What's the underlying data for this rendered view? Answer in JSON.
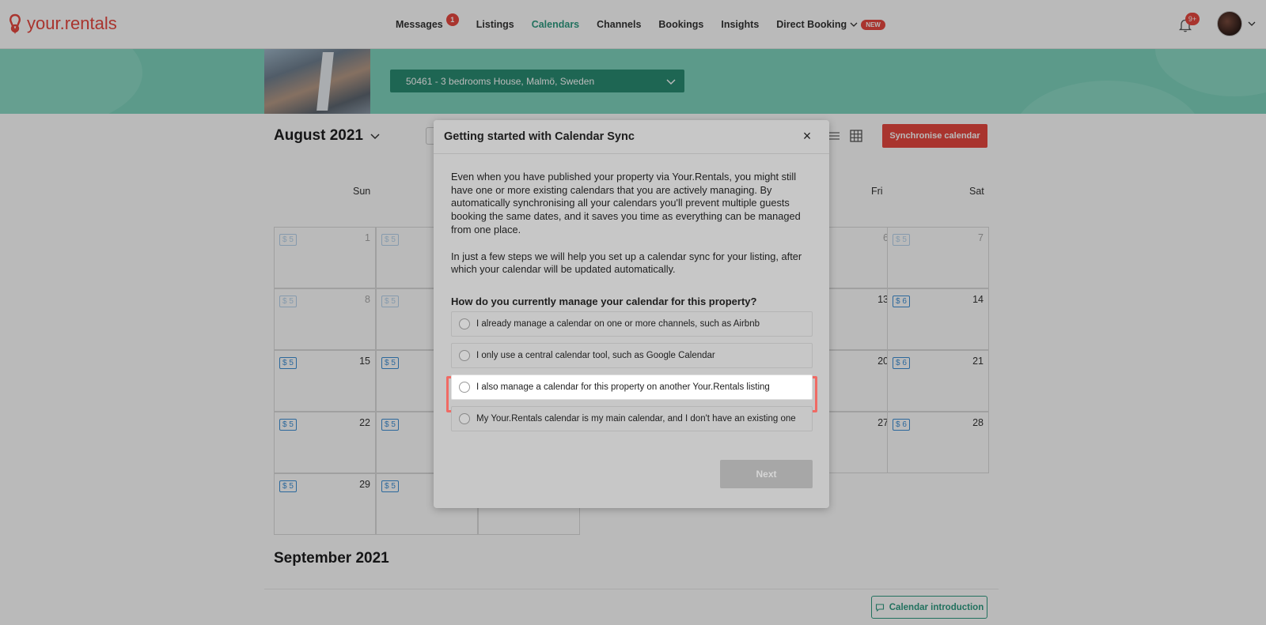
{
  "app": {
    "logo_text": "your.rentals"
  },
  "nav": {
    "items": [
      {
        "label": "Messages",
        "badge": "1"
      },
      {
        "label": "Listings"
      },
      {
        "label": "Calendars",
        "active": true
      },
      {
        "label": "Channels"
      },
      {
        "label": "Bookings"
      },
      {
        "label": "Insights"
      },
      {
        "label": "Direct Booking",
        "tag": "NEW"
      }
    ],
    "notifications_badge": "9+"
  },
  "property": {
    "selector_label": "50461 - 3 bedrooms House, Malmö, Sweden"
  },
  "calendar": {
    "month_title": "August 2021",
    "sync_button": "Synchronise calendar",
    "day_headers": [
      "Sun",
      "Fri",
      "Sat"
    ],
    "cells": [
      {
        "day": "1",
        "price": "$ 5",
        "faded": true
      },
      {
        "day": "",
        "price": "$ 5",
        "faded": true
      },
      {
        "day": "6",
        "price": "",
        "faded": true
      },
      {
        "day": "7",
        "price": "$ 5",
        "faded": true
      },
      {
        "day": "8",
        "price": "$ 5",
        "faded": true
      },
      {
        "day": "",
        "price": "$ 5",
        "faded": true
      },
      {
        "day": "13",
        "price": ""
      },
      {
        "day": "14",
        "price": "$ 6"
      },
      {
        "day": "15",
        "price": "$ 5"
      },
      {
        "day": "",
        "price": "$ 5"
      },
      {
        "day": "20",
        "price": ""
      },
      {
        "day": "21",
        "price": "$ 6"
      },
      {
        "day": "22",
        "price": "$ 5"
      },
      {
        "day": "",
        "price": "$ 5"
      },
      {
        "day": "27",
        "price": ""
      },
      {
        "day": "28",
        "price": "$ 6"
      },
      {
        "day": "29",
        "price": "$ 5"
      },
      {
        "day": "",
        "price": "$ 5"
      }
    ],
    "next_month_title": "September 2021",
    "intro_button": "Calendar introduction"
  },
  "modal": {
    "title": "Getting started with Calendar Sync",
    "close": "×",
    "paragraph1": "Even when you have published your property via Your.Rentals, you might still have one or more existing calendars that you are actively managing. By automatically synchronising all your calendars you'll prevent multiple guests booking the same dates, and it saves you time as everything can be managed from one place.",
    "paragraph2": "In just a few steps we will help you set up a calendar sync for your listing, after which your calendar will be updated automatically.",
    "question": "How do you currently manage your calendar for this property?",
    "options": [
      "I already manage a calendar on one or more channels, such as Airbnb",
      "I only use a central calendar tool, such as Google Calendar",
      "I also manage a calendar for this property on another Your.Rentals listing",
      "My Your.Rentals calendar is my main calendar, and I don't have an existing one"
    ],
    "next_button": "Next"
  }
}
